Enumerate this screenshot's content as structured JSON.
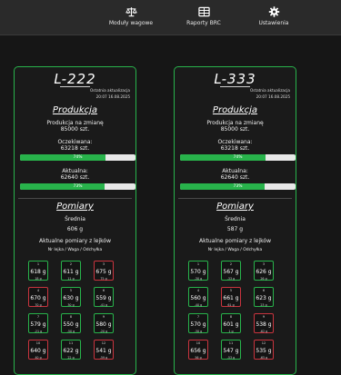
{
  "nav": [
    {
      "icon": "scale-icon",
      "label": "Moduły wagowe"
    },
    {
      "icon": "table-icon",
      "label": "Raporty BRC"
    },
    {
      "icon": "gear-icon",
      "label": "Ustawienia"
    }
  ],
  "colors": {
    "ok": "#28b34b",
    "alert": "#c8343e",
    "bar_bg": "#e8e8e8"
  },
  "cards": [
    {
      "title": "L-222",
      "last_update_label": "Ostatnia aktualizacja",
      "last_update_time": "20:07 16.08.2025",
      "production": {
        "section_title": "Produkcja",
        "shift_label": "Produkcja na zmianę",
        "shift_value": "85000 szt.",
        "expected_label": "Oczekiwana:",
        "expected_value": "63218 szt.",
        "expected_progress": 74,
        "expected_progress_text": "74%",
        "actual_label": "Aktualna:",
        "actual_value": "62640 szt.",
        "actual_progress": 73,
        "actual_progress_text": "73%"
      },
      "measurements": {
        "section_title": "Pomiary",
        "average_label": "Średnia",
        "average_value": "606 g",
        "recent_label": "Aktualne pomiary z lejków",
        "legend": "Nr lejka / Waga / Odchyłka",
        "hoppers": [
          {
            "no": "1",
            "weight": "618 g",
            "diff": "18 g",
            "status": "ok"
          },
          {
            "no": "2",
            "weight": "611 g",
            "diff": "11 g",
            "status": "ok"
          },
          {
            "no": "3",
            "weight": "675 g",
            "diff": "75 g",
            "status": "alert"
          },
          {
            "no": "4",
            "weight": "670 g",
            "diff": "70 g",
            "status": "alert"
          },
          {
            "no": "5",
            "weight": "630 g",
            "diff": "30 g",
            "status": "ok"
          },
          {
            "no": "6",
            "weight": "559 g",
            "diff": "-41 g",
            "status": "ok"
          },
          {
            "no": "7",
            "weight": "579 g",
            "diff": "-21 g",
            "status": "ok"
          },
          {
            "no": "8",
            "weight": "550 g",
            "diff": "-50 g",
            "status": "ok"
          },
          {
            "no": "9",
            "weight": "580 g",
            "diff": "-20 g",
            "status": "ok"
          },
          {
            "no": "10",
            "weight": "640 g",
            "diff": "40 g",
            "status": "alert"
          },
          {
            "no": "11",
            "weight": "622 g",
            "diff": "22 g",
            "status": "ok"
          },
          {
            "no": "12",
            "weight": "541 g",
            "diff": "-59 g",
            "status": "alert"
          }
        ]
      }
    },
    {
      "title": "L-333",
      "last_update_label": "Ostatnia aktualizacja",
      "last_update_time": "20:07 16.08.2025",
      "production": {
        "section_title": "Produkcja",
        "shift_label": "Produkcja na zmianę",
        "shift_value": "85000 szt.",
        "expected_label": "Oczekiwana:",
        "expected_value": "63218 szt.",
        "expected_progress": 74,
        "expected_progress_text": "74%",
        "actual_label": "Aktualna:",
        "actual_value": "62640 szt.",
        "actual_progress": 73,
        "actual_progress_text": "73%"
      },
      "measurements": {
        "section_title": "Pomiary",
        "average_label": "Średnia",
        "average_value": "587 g",
        "recent_label": "Aktualne pomiary z lejków",
        "legend": "Nr lejka / Waga / Odchyłka",
        "hoppers": [
          {
            "no": "1",
            "weight": "570 g",
            "diff": "-30 g",
            "status": "ok"
          },
          {
            "no": "2",
            "weight": "567 g",
            "diff": "-33 g",
            "status": "ok"
          },
          {
            "no": "3",
            "weight": "626 g",
            "diff": "26 g",
            "status": "ok"
          },
          {
            "no": "4",
            "weight": "560 g",
            "diff": "-40 g",
            "status": "ok"
          },
          {
            "no": "5",
            "weight": "661 g",
            "diff": "61 g",
            "status": "alert"
          },
          {
            "no": "6",
            "weight": "623 g",
            "diff": "23 g",
            "status": "ok"
          },
          {
            "no": "7",
            "weight": "570 g",
            "diff": "-30 g",
            "status": "ok"
          },
          {
            "no": "8",
            "weight": "601 g",
            "diff": "1 g",
            "status": "ok"
          },
          {
            "no": "9",
            "weight": "538 g",
            "diff": "-62 g",
            "status": "alert"
          },
          {
            "no": "10",
            "weight": "656 g",
            "diff": "56 g",
            "status": "alert"
          },
          {
            "no": "11",
            "weight": "547 g",
            "diff": "-53 g",
            "status": "ok"
          },
          {
            "no": "12",
            "weight": "535 g",
            "diff": "-65 g",
            "status": "alert"
          }
        ]
      }
    }
  ]
}
